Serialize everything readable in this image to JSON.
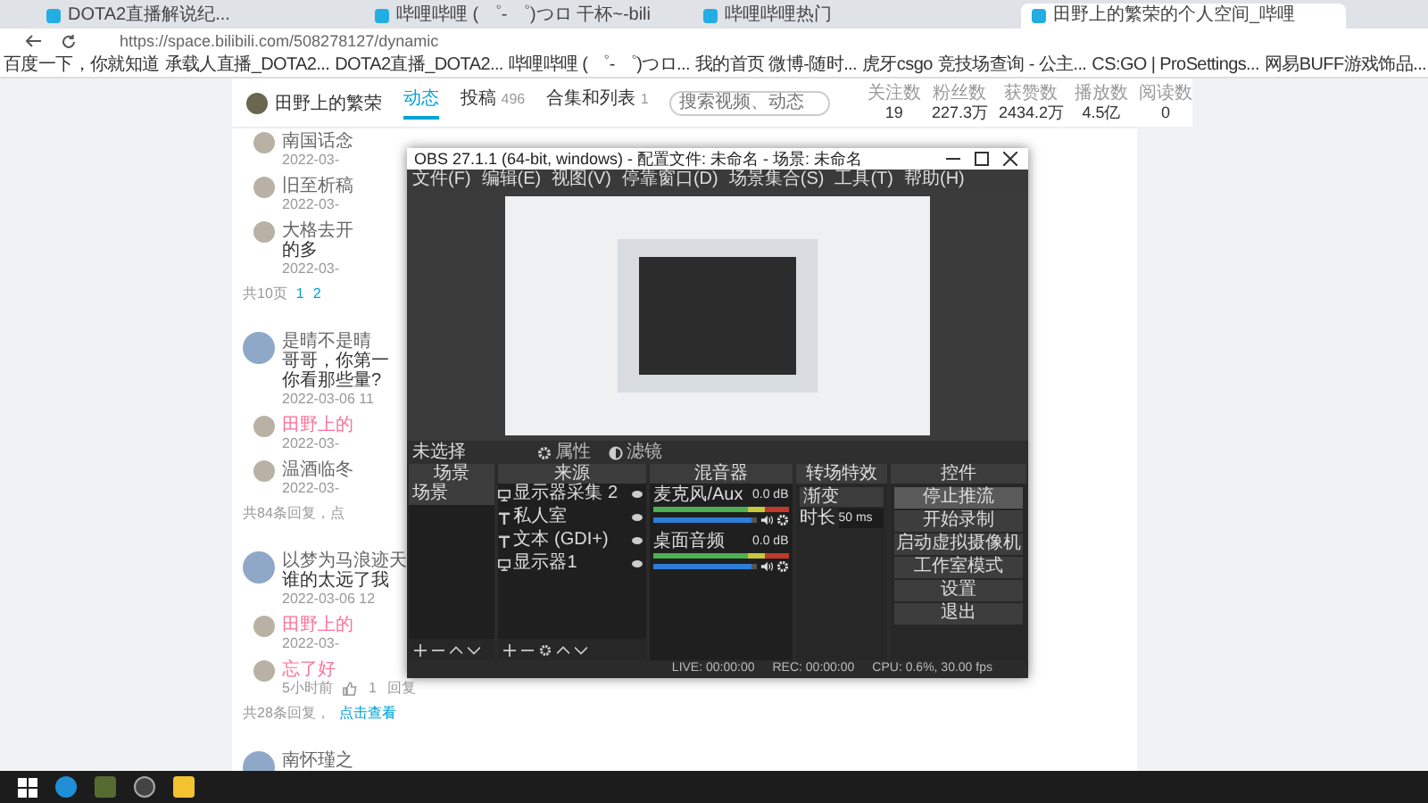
{
  "browser": {
    "tabs": [
      {
        "title": "DOTA2直播解说纪...",
        "selected": false
      },
      {
        "title": "哔哩哔哩 ( ゜- ゜)つロ 干杯~-bili",
        "selected": false
      },
      {
        "title": "哔哩哔哩热门",
        "selected": false
      },
      {
        "title": "田野上的繁荣的个人空间_哔哩",
        "selected": true
      }
    ],
    "url": "https://space.bilibili.com/508278127/dynamic",
    "bookmarks": [
      "百度一下，你就知道",
      "承载人直播_DOTA2...",
      "DOTA2直播_DOTA2...",
      "哔哩哔哩 ( ゜- ゜)つロ...",
      "我的首页 微博-随时...",
      "虎牙csgo",
      "竞技场查询 - 公主...",
      "CS:GO | ProSettings...",
      "网易BUFF游戏饰品..."
    ]
  },
  "profile": {
    "name": "田野上的繁荣",
    "nav": [
      {
        "label": "动态",
        "selected": true
      },
      {
        "label": "投稿",
        "count": "496",
        "selected": false
      },
      {
        "label": "合集和列表",
        "count": "1",
        "selected": false
      }
    ],
    "search_placeholder": "搜索视频、动态",
    "stats": [
      {
        "label": "关注数",
        "value": "19"
      },
      {
        "label": "粉丝数",
        "value": "227.3万"
      },
      {
        "label": "获赞数",
        "value": "2434.2万"
      },
      {
        "label": "播放数",
        "value": "4.5亿"
      },
      {
        "label": "阅读数",
        "value": "0"
      }
    ]
  },
  "comments": [
    {
      "kind": "reply",
      "name": "南国话念",
      "date": "2022-03-",
      "author": false
    },
    {
      "kind": "reply",
      "name": "旧至析稿",
      "date": "2022-03-",
      "author": false
    },
    {
      "kind": "reply",
      "name": "大格去开",
      "text": "的多",
      "date": "2022-03-",
      "author": false
    },
    {
      "kind": "pager",
      "text": "共10页",
      "pages": [
        "1",
        "2"
      ]
    },
    {
      "kind": "comment",
      "name": "是晴不是晴",
      "text": "哥哥，你第一",
      "text2": "你看那些量?",
      "date": "2022-03-06 11"
    },
    {
      "kind": "reply",
      "name": "田野上的",
      "date": "2022-03-",
      "author": true
    },
    {
      "kind": "reply",
      "name": "温酒临冬",
      "date": "2022-03-",
      "author": false
    },
    {
      "kind": "footer",
      "text": "共84条回复，点"
    },
    {
      "kind": "comment",
      "name": "以梦为马浪迹天",
      "text": "谁的太远了我",
      "date": "2022-03-06 12"
    },
    {
      "kind": "reply",
      "name": "田野上的",
      "date": "2022-03-",
      "author": true
    },
    {
      "kind": "reply",
      "name": "忘了好",
      "date": "5小时前",
      "author": true,
      "likes": "1",
      "action": "回复"
    },
    {
      "kind": "footer",
      "text": "共28条回复，",
      "link": "点击查看"
    },
    {
      "kind": "comment",
      "name": "南怀瑾之"
    }
  ],
  "obs": {
    "title": "OBS 27.1.1 (64-bit, windows) - 配置文件: 未命名 - 场景: 未命名",
    "menu": [
      "文件(F)",
      "编辑(E)",
      "视图(V)",
      "停靠窗口(D)",
      "场景集合(S)",
      "工具(T)",
      "帮助(H)"
    ],
    "selection": "未选择",
    "properties": "属性",
    "filters": "滤镜",
    "docks": {
      "scenes": "场景",
      "sources": "来源",
      "mixer": "混音器",
      "transitions": "转场特效",
      "controls": "控件"
    },
    "scenes": [
      {
        "name": "场景",
        "selected": true
      }
    ],
    "sources": [
      {
        "kind": "display",
        "name": "显示器采集 2"
      },
      {
        "kind": "text",
        "name": "私人室"
      },
      {
        "kind": "text",
        "name": "文本 (GDI+)"
      },
      {
        "kind": "display",
        "name": "显示器1"
      }
    ],
    "channels": [
      {
        "name": "麦克风/Aux",
        "reading": "0.0 dB",
        "level": 0.95
      },
      {
        "name": "桌面音频",
        "reading": "0.0 dB",
        "level": 0.95
      }
    ],
    "transition": "渐变",
    "duration_label": "时长",
    "duration": "50 ms",
    "controls": [
      {
        "label": "停止推流",
        "selected": true
      },
      {
        "label": "开始录制",
        "selected": false
      },
      {
        "label": "启动虚拟摄像机",
        "selected": false
      },
      {
        "label": "工作室模式",
        "selected": false
      },
      {
        "label": "设置",
        "selected": false
      },
      {
        "label": "退出",
        "selected": false
      }
    ],
    "status": {
      "live": "LIVE: 00:00:00",
      "rec": "REC: 00:00:00",
      "cpu": "CPU: 0.6%, 30.00 fps"
    }
  }
}
